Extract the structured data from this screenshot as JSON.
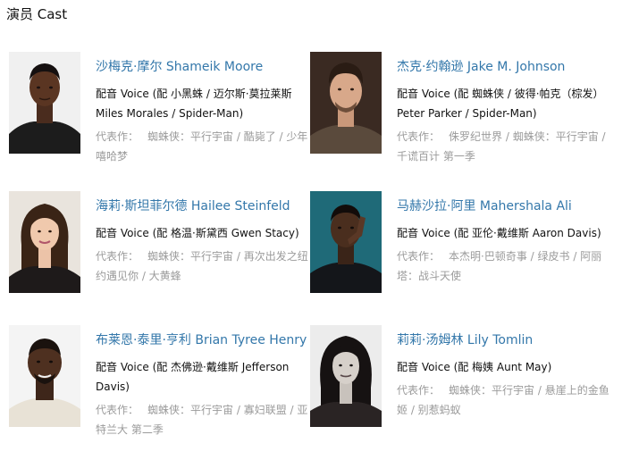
{
  "section": {
    "title": "演员 Cast"
  },
  "cast": [
    {
      "name": "沙梅克·摩尔 Shameik Moore",
      "role": "配音 Voice (配 小黑蛛 / 迈尔斯·莫拉莱斯 Miles Morales / Spider-Man)",
      "works_label": "代表作：",
      "works": "蜘蛛侠：平行宇宙 / 酷毙了 / 少年嘻哈梦"
    },
    {
      "name": "杰克·约翰逊 Jake M. Johnson",
      "role": "配音 Voice (配 蜘蛛侠 / 彼得·帕克（棕发） Peter Parker / Spider-Man)",
      "works_label": "代表作：",
      "works": "侏罗纪世界 / 蜘蛛侠：平行宇宙 / 千谎百计 第一季"
    },
    {
      "name": "海莉·斯坦菲尔德 Hailee Steinfeld",
      "role": "配音 Voice (配 格温·斯黛西 Gwen Stacy)",
      "works_label": "代表作：",
      "works": "蜘蛛侠：平行宇宙 / 再次出发之纽约遇见你 / 大黄蜂"
    },
    {
      "name": "马赫沙拉·阿里 Mahershala Ali",
      "role": "配音 Voice (配 亚伦·戴维斯 Aaron Davis)",
      "works_label": "代表作：",
      "works": "本杰明·巴顿奇事 / 绿皮书 / 阿丽塔：战斗天使"
    },
    {
      "name": "布莱恩·泰里·亨利 Brian Tyree Henry",
      "role": "配音 Voice (配 杰佛逊·戴维斯 Jefferson Davis)",
      "works_label": "代表作：",
      "works": "蜘蛛侠：平行宇宙 / 寡妇联盟 / 亚特兰大 第二季"
    },
    {
      "name": "莉莉·汤姆林 Lily Tomlin",
      "role": "配音 Voice (配 梅姨 Aunt May)",
      "works_label": "代表作：",
      "works": "蜘蛛侠：平行宇宙 / 悬崖上的金鱼姬 / 别惹蚂蚁"
    }
  ]
}
